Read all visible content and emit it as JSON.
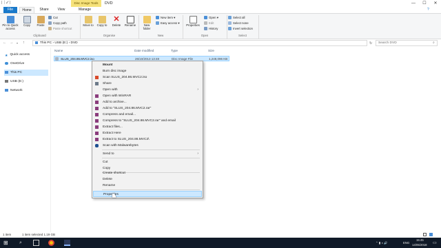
{
  "titlebar": {
    "qat_label": "| ⏐ ✓ |",
    "context_tab": "Disc Image Tools",
    "title": "DVD",
    "min": "—",
    "max": "☐",
    "close": "✕"
  },
  "tabs": [
    "File",
    "Home",
    "Share",
    "View",
    "Manage"
  ],
  "ribbon": {
    "clipboard": {
      "pin": "Pin to Quick access",
      "copy": "Copy",
      "paste": "Paste",
      "cut": "Cut",
      "copy_path": "Copy path",
      "paste_shortcut": "Paste shortcut",
      "group": "Clipboard"
    },
    "organise": {
      "move_to": "Move to",
      "copy_to": "Copy to",
      "delete": "Delete",
      "rename": "Rename",
      "group": "Organise"
    },
    "new": {
      "new_folder": "New folder",
      "new_item": "New item",
      "easy_access": "Easy access",
      "group": "New"
    },
    "open": {
      "properties": "Properties",
      "open": "Open",
      "edit": "Edit",
      "history": "History",
      "group": "Open"
    },
    "select": {
      "select_all": "Select all",
      "select_none": "Select none",
      "invert": "Invert selection",
      "group": "Select"
    }
  },
  "address": {
    "path": "This PC  ›  USB (E:)  ›  DVD",
    "search_placeholder": "Search DVD"
  },
  "nav": [
    {
      "label": "Quick access"
    },
    {
      "label": "OneDrive"
    },
    {
      "label": "This PC"
    },
    {
      "label": "USB (E:)"
    },
    {
      "label": "Network"
    }
  ],
  "columns": {
    "name": "Name",
    "date": "Date modified",
    "type": "Type",
    "size": "Size"
  },
  "files": [
    {
      "name": "SLUS_204.86.MVC2.iso",
      "date": "26/10/2013 13:48",
      "type": "Disc Image File",
      "size": "1,248,096 KB"
    }
  ],
  "context_menu": {
    "mount": "Mount",
    "burn": "Burn disc image",
    "scan": "Scan SLUS_204.86.MVC2.iso",
    "share": "Share",
    "open_with": "Open with",
    "open_winrar": "Open with WinRAR",
    "add_archive": "Add to archive...",
    "add_rar": "Add to \"SLUS_204.86.MVC2.rar\"",
    "compress_email": "Compress and email...",
    "compress_rar_email": "Compress to \"SLUS_204.86.MVC2.rar\" and email",
    "extract_files": "Extract files...",
    "extract_here": "Extract Here",
    "extract_to": "Extract to SLUS_204.86.MVC2\\",
    "malwarebytes": "Scan with Malwarebytes",
    "send_to": "Send to",
    "cut": "Cut",
    "copy": "Copy",
    "create_shortcut": "Create shortcut",
    "delete": "Delete",
    "rename": "Rename",
    "properties": "Properties",
    "arrow": "›"
  },
  "status": {
    "items": "1 item",
    "selected": "1 item selected  1.19 GB"
  },
  "taskbar": {
    "lang": "ENG",
    "time": "15:45",
    "date": "14/05/2018"
  },
  "colors": {
    "accent": "#1979ca",
    "selection": "#cce8ff",
    "context_tab": "#f6e27a",
    "taskbar": "#101a28"
  }
}
